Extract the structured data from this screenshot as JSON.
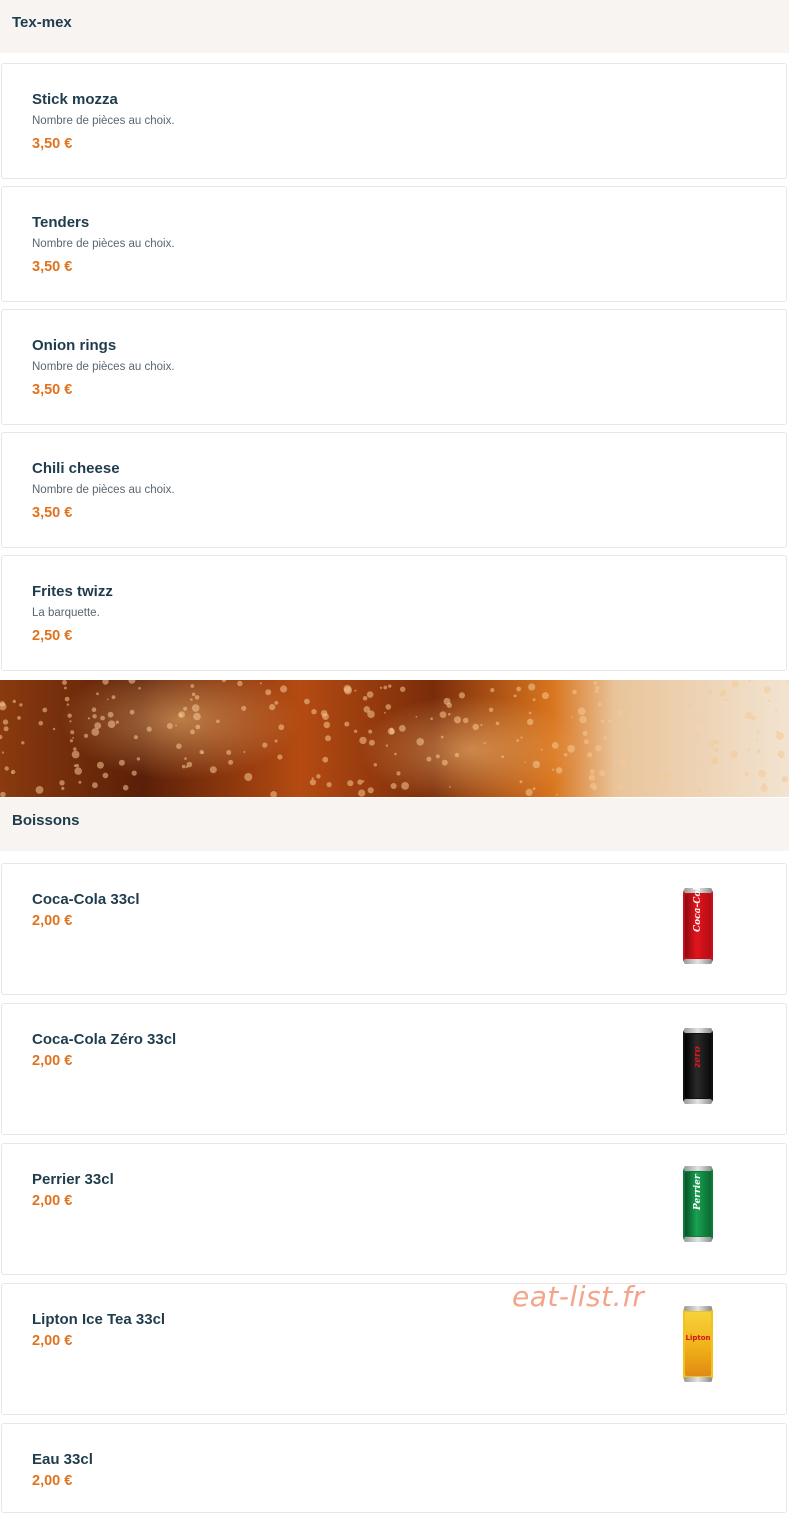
{
  "sections": [
    {
      "title": "Tex-mex",
      "items": [
        {
          "name": "Stick mozza",
          "description": "Nombre de pièces au choix.",
          "price": "3,50 €"
        },
        {
          "name": "Tenders",
          "description": "Nombre de pièces au choix.",
          "price": "3,50 €"
        },
        {
          "name": "Onion rings",
          "description": "Nombre de pièces au choix.",
          "price": "3,50 €"
        },
        {
          "name": "Chili cheese",
          "description": "Nombre de pièces au choix.",
          "price": "3,50 €"
        },
        {
          "name": "Frites twizz",
          "description": "La barquette.",
          "price": "2,50 €"
        }
      ]
    },
    {
      "title": "Boissons",
      "items": [
        {
          "name": "Coca-Cola 33cl",
          "price": "2,00 €",
          "image": "coca-cola-can",
          "logo": "Coca-Cola"
        },
        {
          "name": "Coca-Cola Zéro 33cl",
          "price": "2,00 €",
          "image": "coca-cola-zero-can",
          "logo": "zero"
        },
        {
          "name": "Perrier 33cl",
          "price": "2,00 €",
          "image": "perrier-can",
          "logo": "Perrier"
        },
        {
          "name": "Lipton Ice Tea 33cl",
          "price": "2,00 €",
          "image": "lipton-ice-tea-can",
          "logo": "Lipton"
        },
        {
          "name": "Eau 33cl",
          "price": "2,00 €"
        }
      ]
    }
  ],
  "banner_image": "soda-bubbles-banner",
  "watermark": "eat-list.fr",
  "colors": {
    "price": "#e0731f",
    "title": "#1f3c4d",
    "section_bg": "#f7f4f1",
    "card_border": "#e9e7e4"
  }
}
